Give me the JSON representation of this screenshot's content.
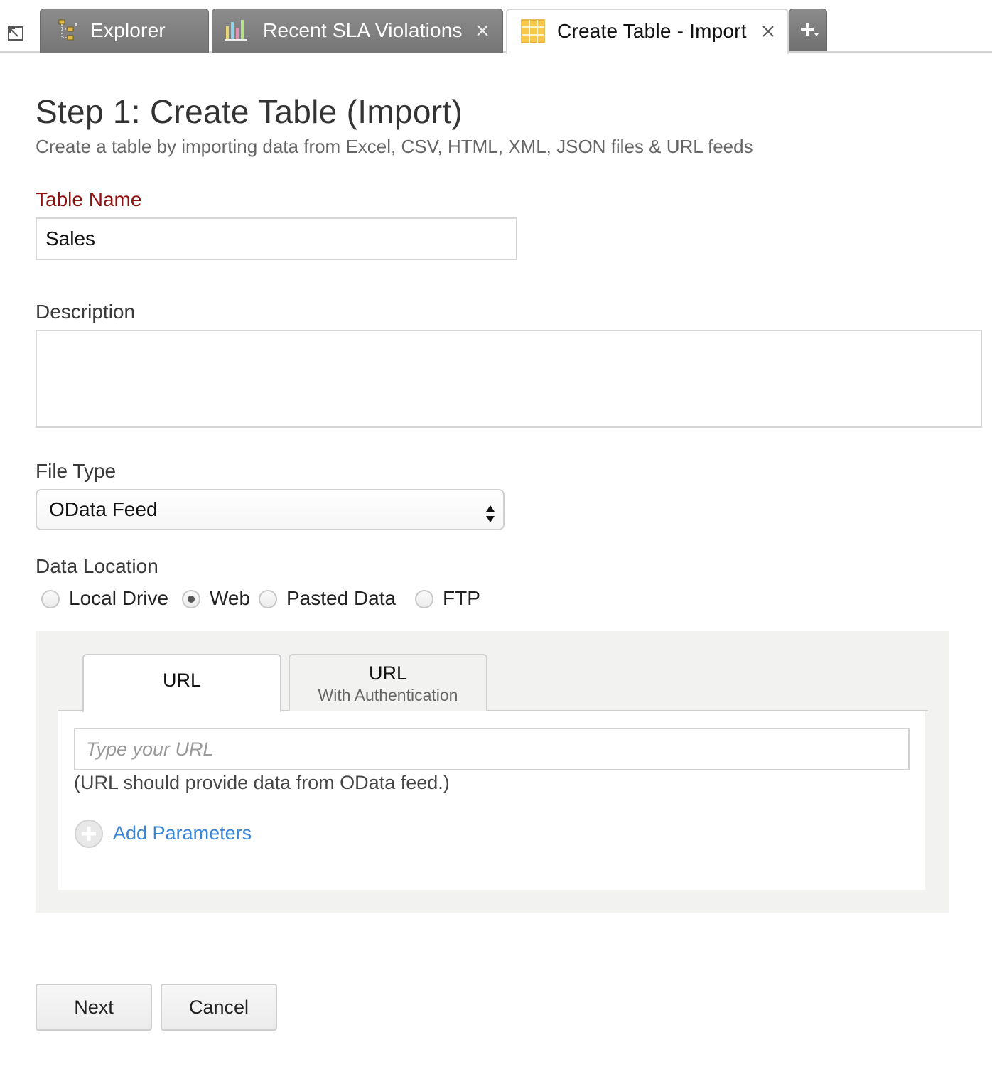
{
  "tabs": [
    {
      "label": "Explorer",
      "icon": "explorer-tree-icon",
      "closable": false,
      "active": false
    },
    {
      "label": "Recent SLA Violations",
      "icon": "bar-chart-icon",
      "closable": true,
      "active": false
    },
    {
      "label": "Create Table - Import",
      "icon": "table-grid-icon",
      "closable": true,
      "active": true
    }
  ],
  "new_tab_icon": "plus-dropdown-icon",
  "corner_icon": "expand-arrow-icon",
  "page": {
    "title": "Step 1: Create Table (Import)",
    "subtitle": "Create a table by importing data from Excel, CSV, HTML, XML, JSON files & URL feeds"
  },
  "form": {
    "table_name_label": "Table Name",
    "table_name_value": "Sales",
    "description_label": "Description",
    "description_value": "",
    "file_type_label": "File Type",
    "file_type_value": "OData Feed",
    "data_location_label": "Data Location",
    "data_location_options": [
      "Local Drive",
      "Web",
      "Pasted Data",
      "FTP"
    ],
    "data_location_selected": "Web"
  },
  "source_panel": {
    "tabs": [
      {
        "title": "URL",
        "subtitle": ""
      },
      {
        "title": "URL",
        "subtitle": "With Authentication"
      }
    ],
    "url_placeholder": "Type your URL",
    "url_hint": "(URL should provide data from OData feed.)",
    "add_parameters_label": "Add Parameters"
  },
  "buttons": {
    "next": "Next",
    "cancel": "Cancel"
  },
  "colors": {
    "required_label": "#8e1010",
    "link": "#3a86d6",
    "dark_tab": "#7e7e7e",
    "panel_bg": "#f2f2f1"
  }
}
